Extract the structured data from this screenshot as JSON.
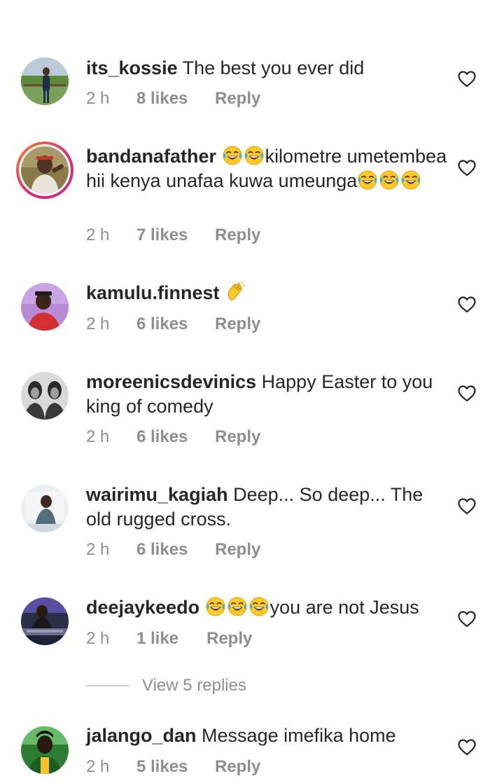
{
  "icons": {
    "like": "heart-outline-icon",
    "laugh": "face-with-tears-of-joy-emoji",
    "clap": "clapping-hands-emoji"
  },
  "colors": {
    "text": "#262626",
    "meta": "#8e8e8e",
    "story_ring": "#dd2a7b"
  },
  "comments": [
    {
      "username": "its_kossie",
      "text": "The best you ever did",
      "time": "2 h",
      "likes": "8 likes",
      "reply": "Reply"
    },
    {
      "username": "bandanafather",
      "text_a": "kilometre umetembea hii kenya unafaa kuwa umeunga",
      "time": "2 h",
      "likes": "7 likes",
      "reply": "Reply"
    },
    {
      "username": "kamulu.finnest",
      "text": "",
      "time": "2 h",
      "likes": "6 likes",
      "reply": "Reply"
    },
    {
      "username": "moreenicsdevinics",
      "text": "Happy Easter to you king of comedy",
      "time": "2 h",
      "likes": "6 likes",
      "reply": "Reply"
    },
    {
      "username": "wairimu_kagiah",
      "text": "Deep... So deep... The old rugged cross.",
      "time": "2 h",
      "likes": "6 likes",
      "reply": "Reply"
    },
    {
      "username": "deejaykeedo",
      "text": "you are not Jesus",
      "time": "2 h",
      "likes": "1 like",
      "reply": "Reply"
    },
    {
      "username": "jalango_dan",
      "text": "Message imefika home",
      "time": "2 h",
      "likes": "5 likes",
      "reply": "Reply"
    }
  ],
  "view_replies": "View 5 replies"
}
